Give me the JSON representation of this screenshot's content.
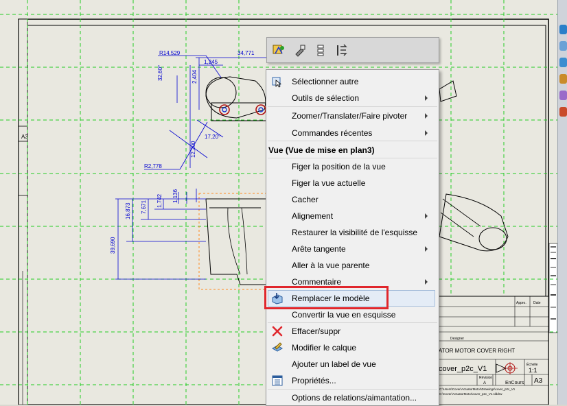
{
  "mini_toolbar": {
    "buttons": [
      {
        "name": "Smart Dimension",
        "icon": "smart-dimension-icon"
      },
      {
        "name": "Format Painter",
        "icon": "format-painter-icon"
      },
      {
        "name": "Align",
        "icon": "align-icon"
      },
      {
        "name": "Replace",
        "icon": "replace-view-icon"
      }
    ]
  },
  "menu": {
    "items": [
      {
        "label": "Sélectionner autre",
        "icon": "select-other-icon",
        "submenu": false
      },
      {
        "label": "Outils de sélection",
        "submenu": true
      },
      {
        "label": "Zoomer/Translater/Faire pivoter",
        "submenu": true
      },
      {
        "label": "Commandes récentes",
        "submenu": true
      }
    ],
    "section_title": "Vue (Vue de mise en plan3)",
    "view_items": [
      {
        "label": "Figer la position de la vue",
        "submenu": false
      },
      {
        "label": "Figer la vue actuelle",
        "submenu": false
      },
      {
        "label": "Cacher",
        "submenu": false
      },
      {
        "label": "Alignement",
        "submenu": true
      },
      {
        "label": "Restaurer la visibilité de l'esquisse",
        "submenu": false
      },
      {
        "label": "Arête tangente",
        "submenu": true
      },
      {
        "label": "Aller à la vue parente",
        "submenu": false
      },
      {
        "label": "Commentaire",
        "submenu": true
      },
      {
        "label": "Remplacer le modèle",
        "icon": "replace-model-icon",
        "submenu": false,
        "highlighted": true
      },
      {
        "label": "Convertir la vue en esquisse",
        "submenu": false
      },
      {
        "label": "Effacer/suppr",
        "icon": "delete-icon",
        "submenu": false
      },
      {
        "label": "Modifier le calque",
        "icon": "layer-icon",
        "submenu": false
      },
      {
        "label": "Ajouter un label de vue",
        "submenu": false
      },
      {
        "label": "Propriétés...",
        "icon": "properties-icon",
        "submenu": false
      },
      {
        "label": "Options de relations/aimantation...",
        "submenu": false
      }
    ]
  },
  "drawing": {
    "dims": {
      "r1": "R14,529",
      "d2": "34,771",
      "d3": "1,245",
      "d4": "32,60°",
      "d5": "2,404",
      "d6": "12,200",
      "d7": "17,20°",
      "r8": "R2,778",
      "d9": "39,690",
      "d10": "16,873",
      "d11": "7,671",
      "d12": "1,742",
      "d13": "1,136"
    },
    "sheet_zone": "A3",
    "title_block": {
      "title": "ATOR MOTOR COVER RIGHT",
      "filename": "cover_p2c_V1",
      "scale_label": "Échelle",
      "scale": "1:1",
      "size": "A3",
      "status": "EnCours",
      "rev_label": "Révision",
      "rev": "A",
      "appro": "Appro.",
      "date": "Date",
      "designer": "Designer",
      "path1": "C:\\Users\\Cover\\ActuatorMotor\\Drawings\\cover_p2c_V1",
      "path2": "C:\\Cover\\ActuatorMotor\\cover_p2c_V1.slddrw"
    }
  },
  "colors": {
    "dimension": "#0000d0",
    "grid": "#22cc22",
    "highlight_border": "#e0262c",
    "hover_fill": "#e4ecf6"
  }
}
